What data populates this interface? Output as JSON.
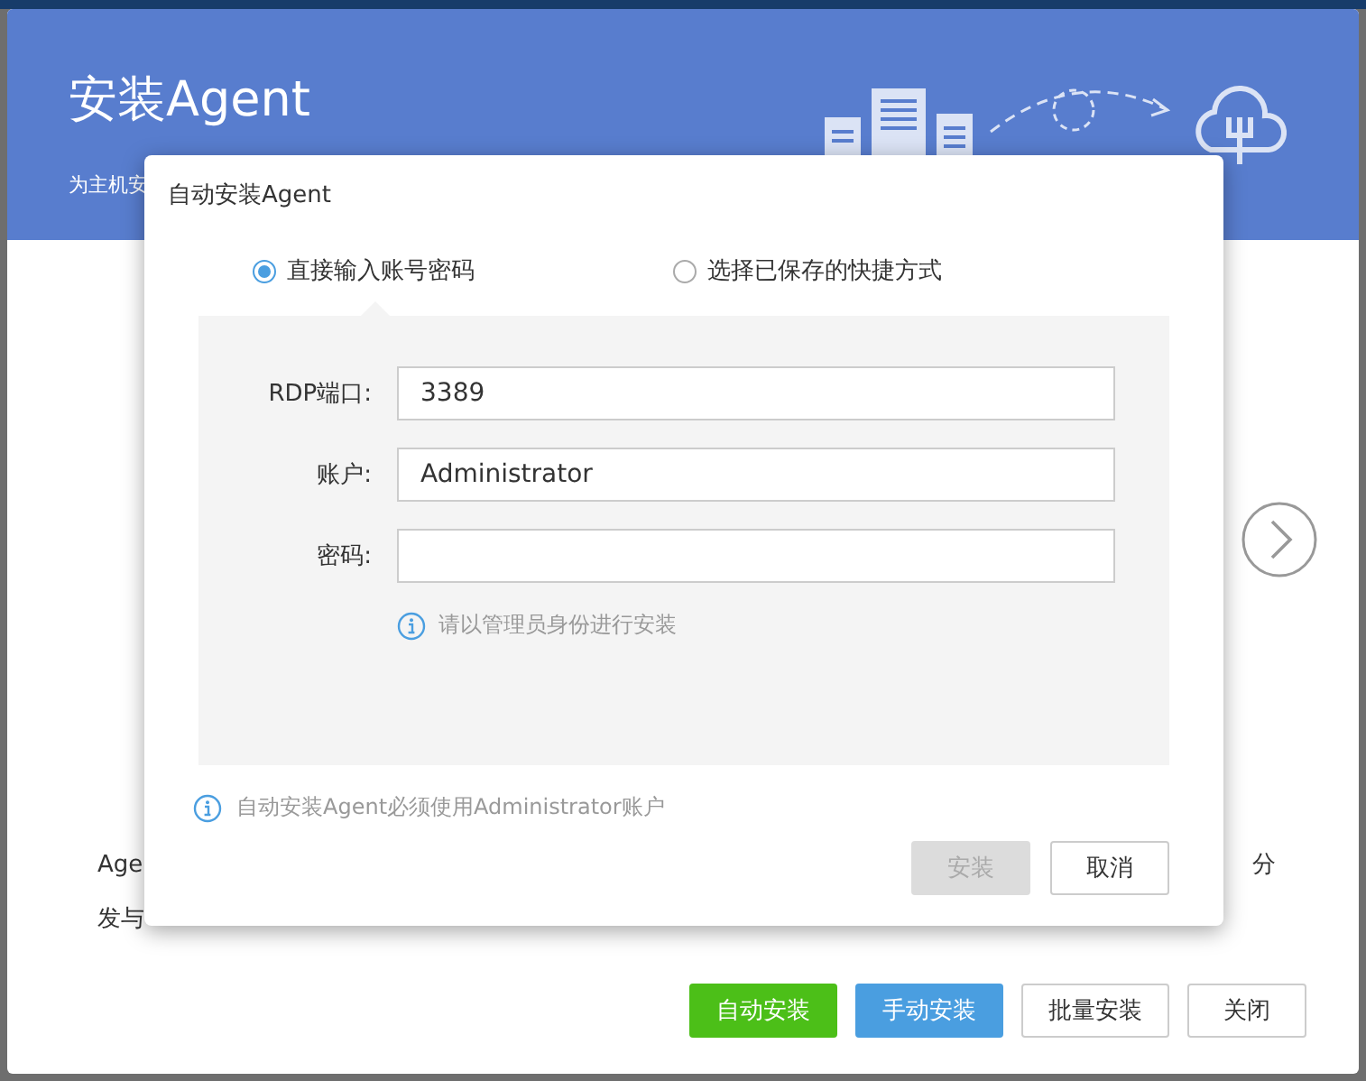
{
  "window": {
    "title": "安装Agent",
    "subtitle": "为主机安"
  },
  "description": {
    "line_1_start": "Age",
    "line_1_end": "分",
    "line_2_start": "发与"
  },
  "footer_buttons": [
    {
      "label": "自动安装",
      "kind": "success"
    },
    {
      "label": "手动安装",
      "kind": "primary"
    },
    {
      "label": "批量安装",
      "kind": "default"
    },
    {
      "label": "关闭",
      "kind": "default"
    }
  ],
  "dialog": {
    "title": "自动安装Agent",
    "modes": [
      {
        "label": "直接输入账号密码",
        "selected": true
      },
      {
        "label": "选择已保存的快捷方式",
        "selected": false
      }
    ],
    "fields": [
      {
        "label": "RDP端口:",
        "value": "3389"
      },
      {
        "label": "账户:",
        "value": "Administrator"
      },
      {
        "label": "密码:"
      }
    ],
    "hint": "请以管理员身份进行安装",
    "note": "自动安装Agent必须使用Administrator账户",
    "buttons": [
      {
        "label": "安装",
        "disabled": true
      },
      {
        "label": "取消",
        "disabled": false
      }
    ]
  }
}
